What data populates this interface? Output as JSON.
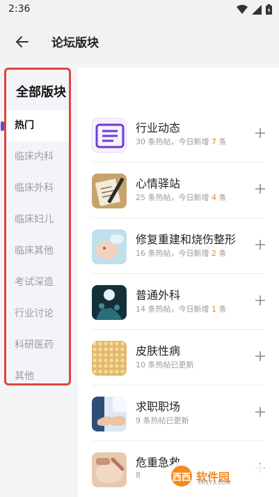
{
  "status_bar": {
    "time": "2:36"
  },
  "app_bar": {
    "title": "论坛版块"
  },
  "sidebar": {
    "header": "全部版块",
    "categories": [
      "热门",
      "临床内科",
      "临床外科",
      "临床妇儿",
      "临床其他",
      "考试深造",
      "行业讨论",
      "科研医药",
      "其他"
    ],
    "active_index": 0,
    "accent_color": "#5b4fd9",
    "highlight_border_color": "#e0443a"
  },
  "forums": [
    {
      "name": "行业动态",
      "meta_prefix": "30 条热帖，今日新增 ",
      "new_count": "7",
      "meta_suffix": " 条",
      "icon": "industry-news-icon",
      "icon_text": "行业动态"
    },
    {
      "name": "心情驿站",
      "meta_prefix": "25 条热帖，今日新增 ",
      "new_count": "4",
      "meta_suffix": " 条",
      "icon": "notebook-pen-icon"
    },
    {
      "name": "修复重建和烧伤整形",
      "meta_prefix": "16 条热帖，今日新增 ",
      "new_count": "2",
      "meta_suffix": " 条",
      "icon": "face-treatment-icon"
    },
    {
      "name": "普通外科",
      "meta_prefix": "14 条热帖，今日新增 ",
      "new_count": "1",
      "meta_suffix": " 条",
      "icon": "surgery-room-icon"
    },
    {
      "name": "皮肤性病",
      "meta_prefix": "10 条热帖已更新",
      "new_count": "",
      "meta_suffix": "",
      "icon": "skin-texture-icon"
    },
    {
      "name": "求职职场",
      "meta_prefix": "9 条热帖已更新",
      "new_count": "",
      "meta_suffix": "",
      "icon": "handshake-icon"
    },
    {
      "name": "危重急救",
      "meta_prefix": "8",
      "new_count": "",
      "meta_suffix": "",
      "icon": "emergency-care-icon"
    }
  ],
  "watermark": {
    "logo": "西西",
    "text": "软件园",
    "sub": "CR173.COM"
  }
}
